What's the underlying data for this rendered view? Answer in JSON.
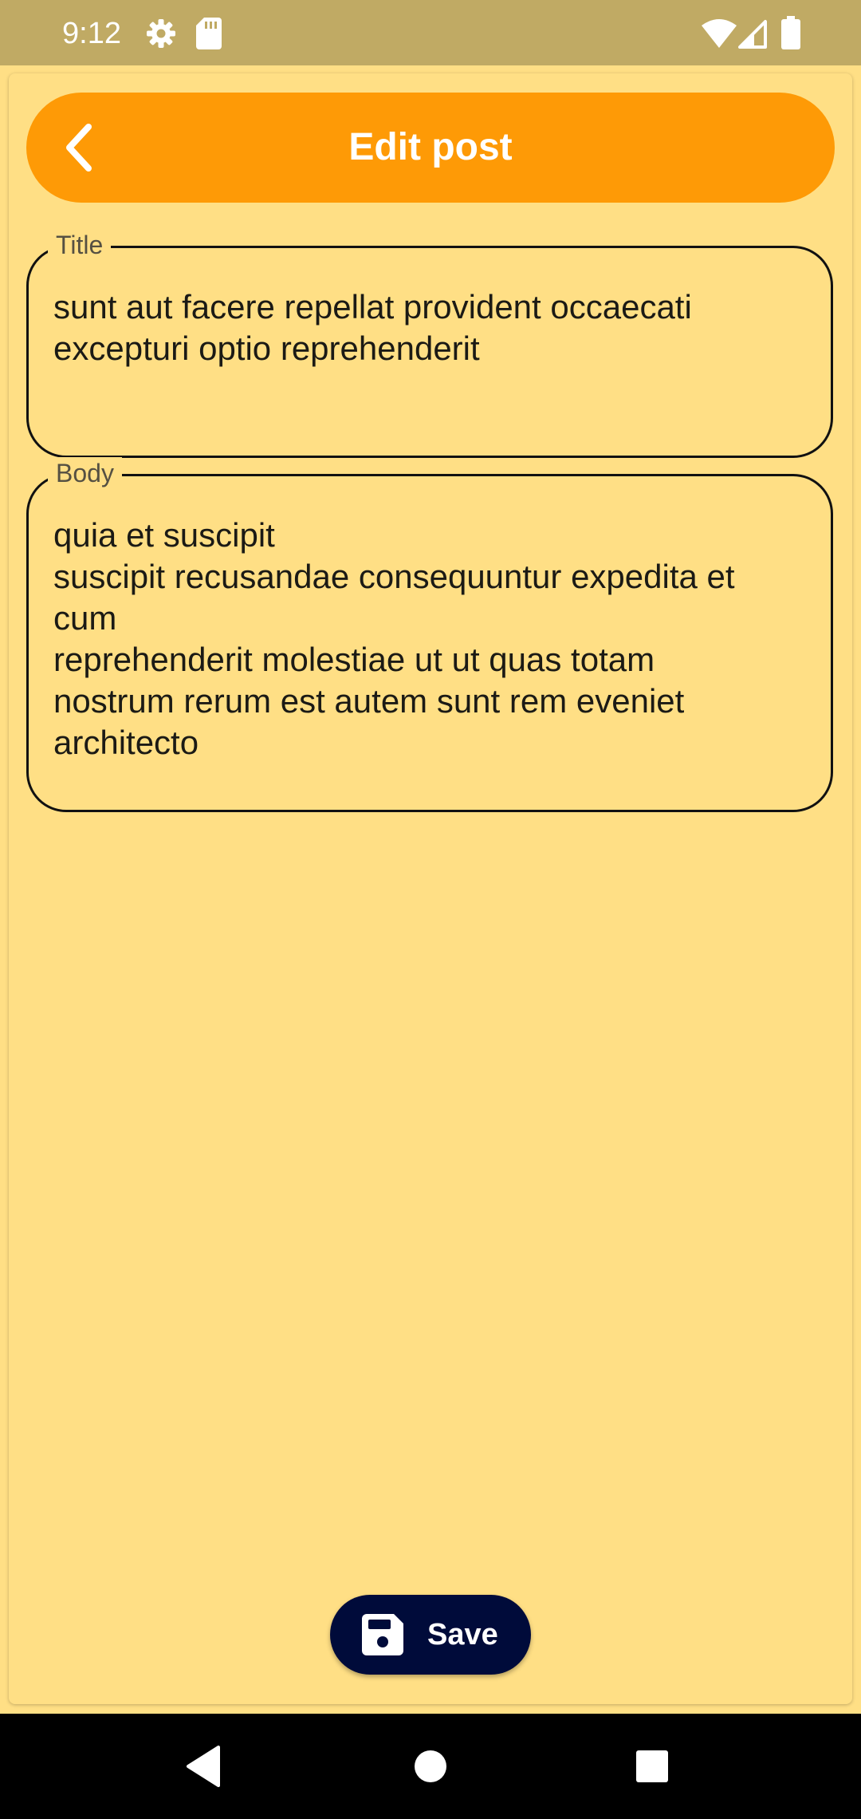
{
  "status_bar": {
    "time": "9:12",
    "icons": [
      "settings-gear-icon",
      "sd-card-icon",
      "wifi-icon",
      "cell-signal-icon",
      "battery-icon"
    ]
  },
  "app_bar": {
    "title": "Edit post",
    "back_icon": "chevron-left-icon",
    "background_color": "#FE9A06"
  },
  "form": {
    "title_field": {
      "label": "Title",
      "value": "sunt aut facere repellat provident occaecati\nexcepturi optio reprehenderit"
    },
    "body_field": {
      "label": "Body",
      "value": "quia et suscipit\nsuscipit recusandae consequuntur expedita et\ncum\nreprehenderit molestiae ut ut quas totam\nnostrum rerum est autem sunt rem eveniet\narchitecto"
    }
  },
  "save_button": {
    "label": "Save",
    "icon": "floppy-disk-icon",
    "background_color": "#000B3A"
  },
  "nav_bar": {
    "buttons": [
      "back-triangle-icon",
      "home-circle-icon",
      "recents-square-icon"
    ]
  },
  "colors": {
    "page_background": "#FFDF85",
    "status_bar": "#C0AA64"
  }
}
